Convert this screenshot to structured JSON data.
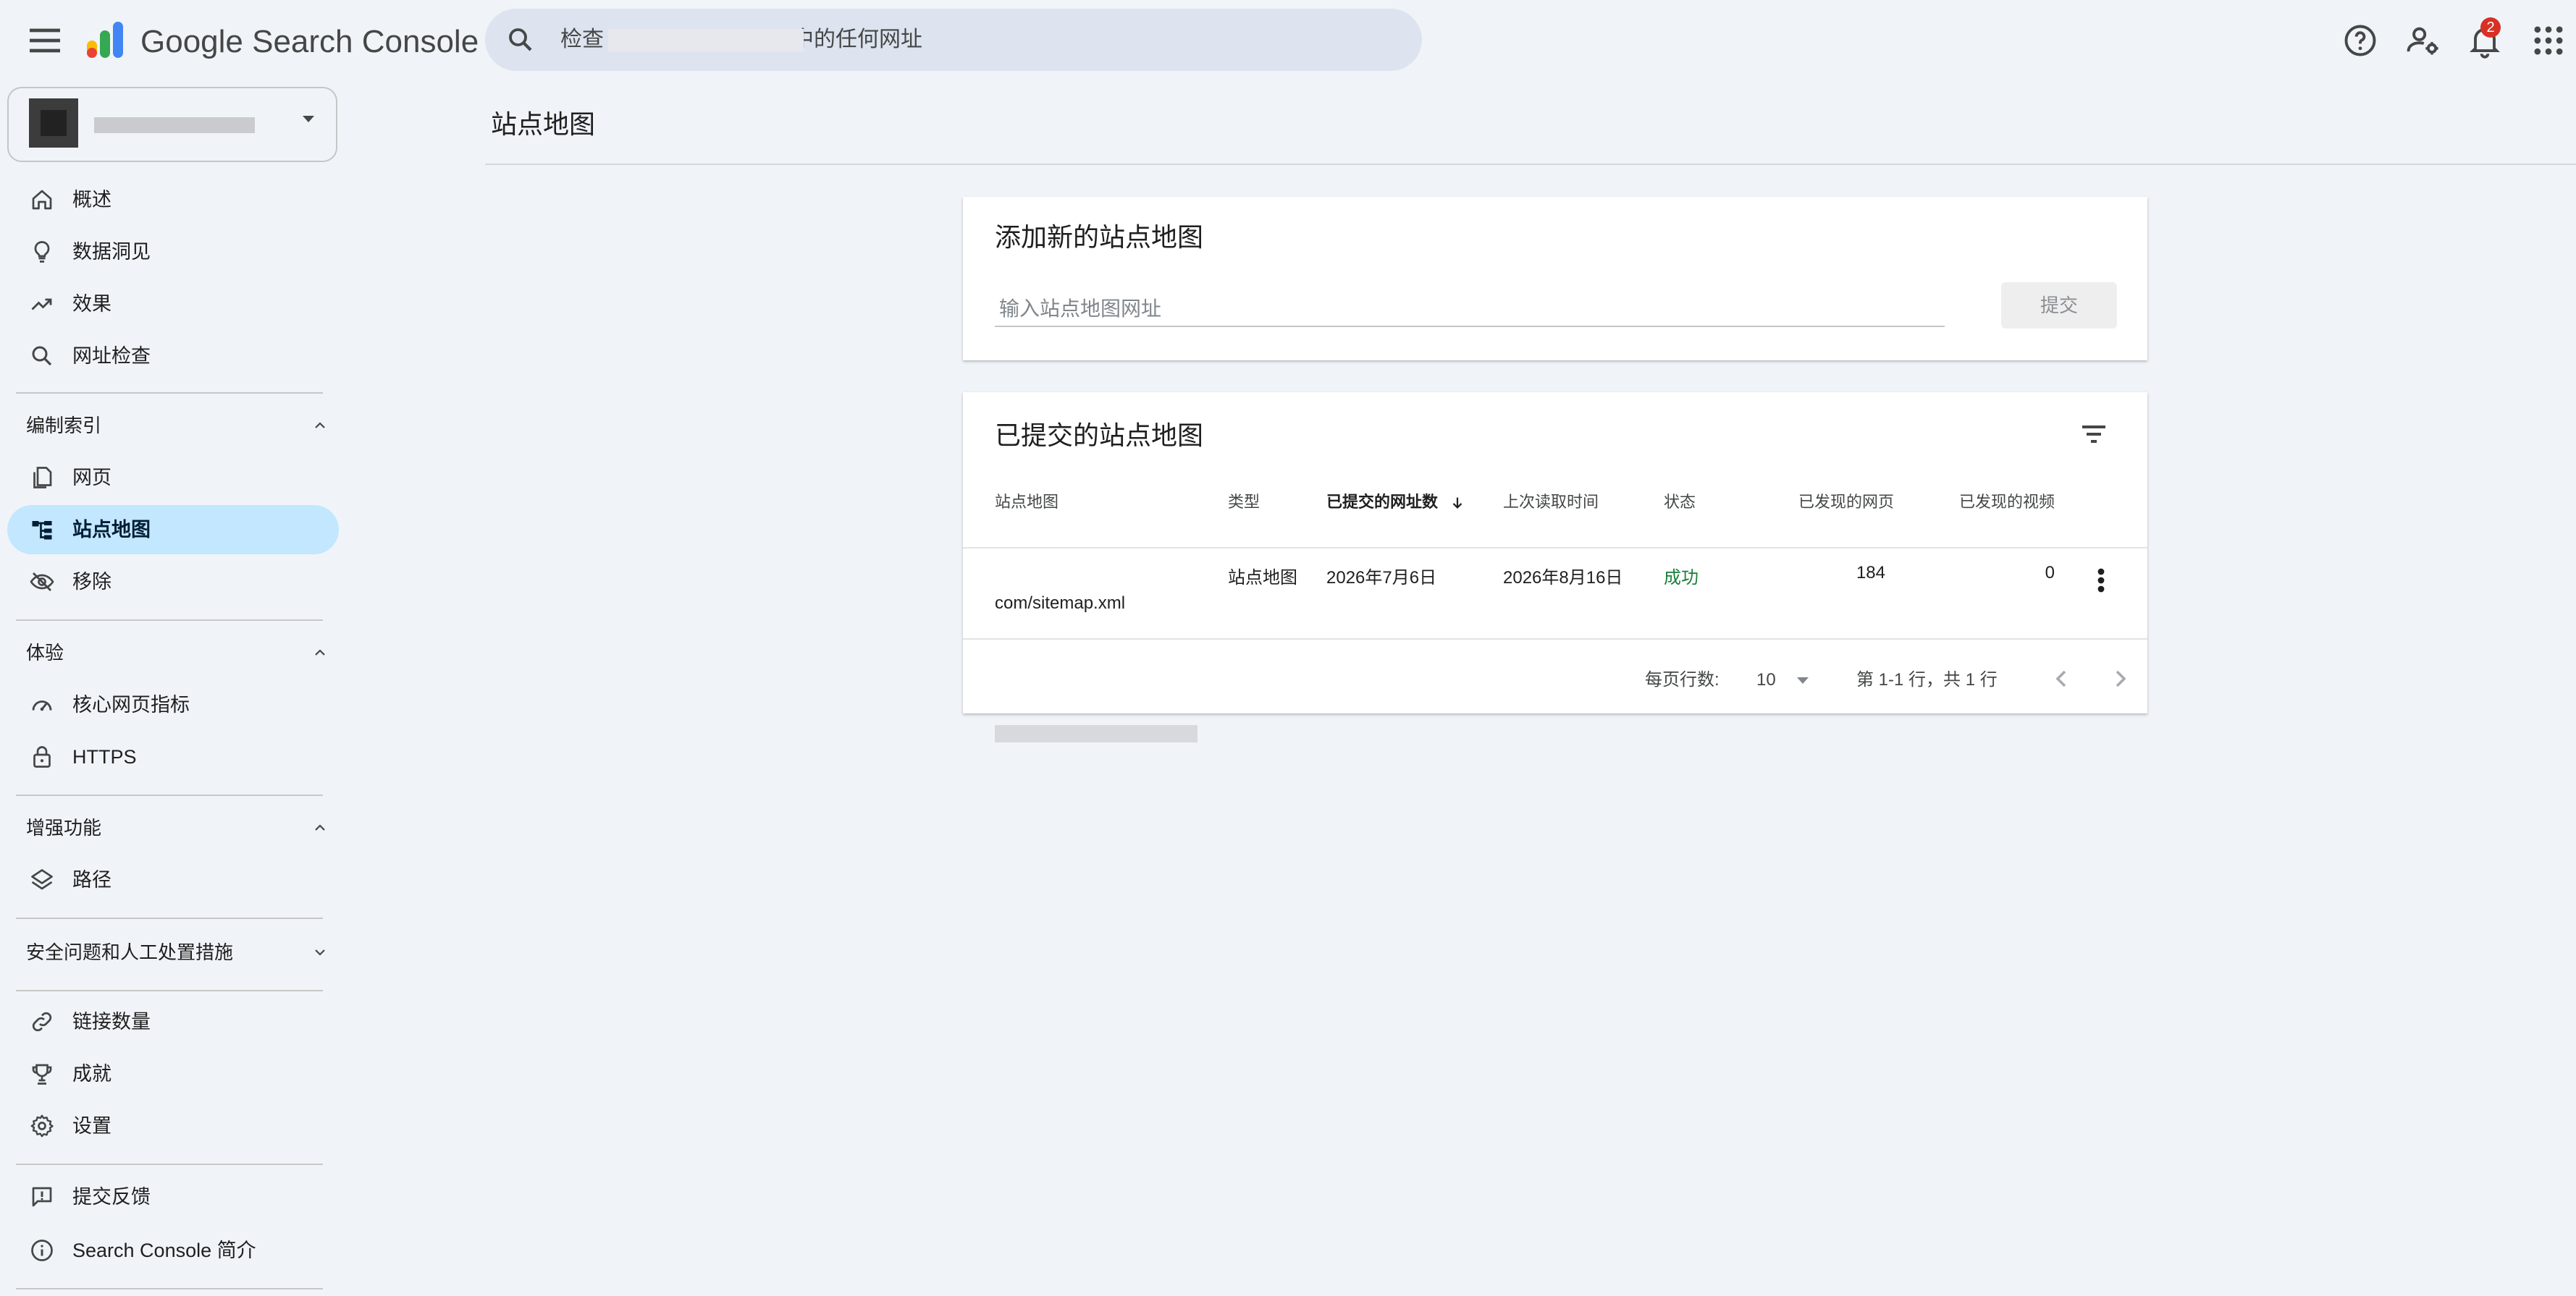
{
  "app": {
    "product_name": "Google Search Console",
    "search": {
      "placeholder": "检查 中的任何网址",
      "prefix": "检查",
      "suffix": "中的任何网址"
    },
    "notifications_count": "2"
  },
  "sidebar": {
    "top_items": [
      {
        "label": "概述",
        "icon": "home-icon"
      },
      {
        "label": "数据洞见",
        "icon": "lightbulb-icon"
      },
      {
        "label": "效果",
        "icon": "trending-up-icon"
      },
      {
        "label": "网址检查",
        "icon": "search-icon"
      }
    ],
    "sections": [
      {
        "title": "编制索引",
        "expanded": true,
        "items": [
          {
            "label": "网页",
            "icon": "pages-icon"
          },
          {
            "label": "站点地图",
            "icon": "sitemap-icon",
            "active": true
          },
          {
            "label": "移除",
            "icon": "visibility-off-icon"
          }
        ]
      },
      {
        "title": "体验",
        "expanded": true,
        "items": [
          {
            "label": "核心网页指标",
            "icon": "speed-gauge-icon"
          },
          {
            "label": "HTTPS",
            "icon": "lock-icon"
          }
        ]
      },
      {
        "title": "增强功能",
        "expanded": true,
        "items": [
          {
            "label": "路径",
            "icon": "layers-icon"
          }
        ]
      },
      {
        "title": "安全问题和人工处置措施",
        "expanded": false,
        "items": []
      }
    ],
    "bottom_items": [
      {
        "label": "链接数量",
        "icon": "link-icon"
      },
      {
        "label": "成就",
        "icon": "trophy-icon"
      },
      {
        "label": "设置",
        "icon": "gear-icon"
      }
    ],
    "footer_items": [
      {
        "label": "提交反馈",
        "icon": "feedback-icon"
      },
      {
        "label": "Search Console 简介",
        "icon": "info-icon"
      }
    ]
  },
  "page": {
    "title": "站点地图",
    "add_card": {
      "title": "添加新的站点地图",
      "input_placeholder": "输入站点地图网址",
      "submit_label": "提交"
    },
    "list_card": {
      "title": "已提交的站点地图",
      "columns": [
        "站点地图",
        "类型",
        "已提交的网址数",
        "上次读取时间",
        "状态",
        "已发现的网页",
        "已发现的视频"
      ],
      "sorted_column": "已提交的网址数",
      "rows": [
        {
          "sitemap": "com/sitemap.xml",
          "type": "站点地图",
          "submitted": "2026年7月6日",
          "last_read": "2026年8月16日",
          "status": "成功",
          "pages": "184",
          "videos": "0"
        }
      ],
      "footer": {
        "rows_per_page_label": "每页行数:",
        "rows_per_page": "10",
        "range_text": "第 1-1 行，共 1 行"
      }
    }
  },
  "colors": {
    "accent": "#c2e7ff",
    "background": "#f0f4f9",
    "status_success": "#188038",
    "badge": "#d93025"
  }
}
